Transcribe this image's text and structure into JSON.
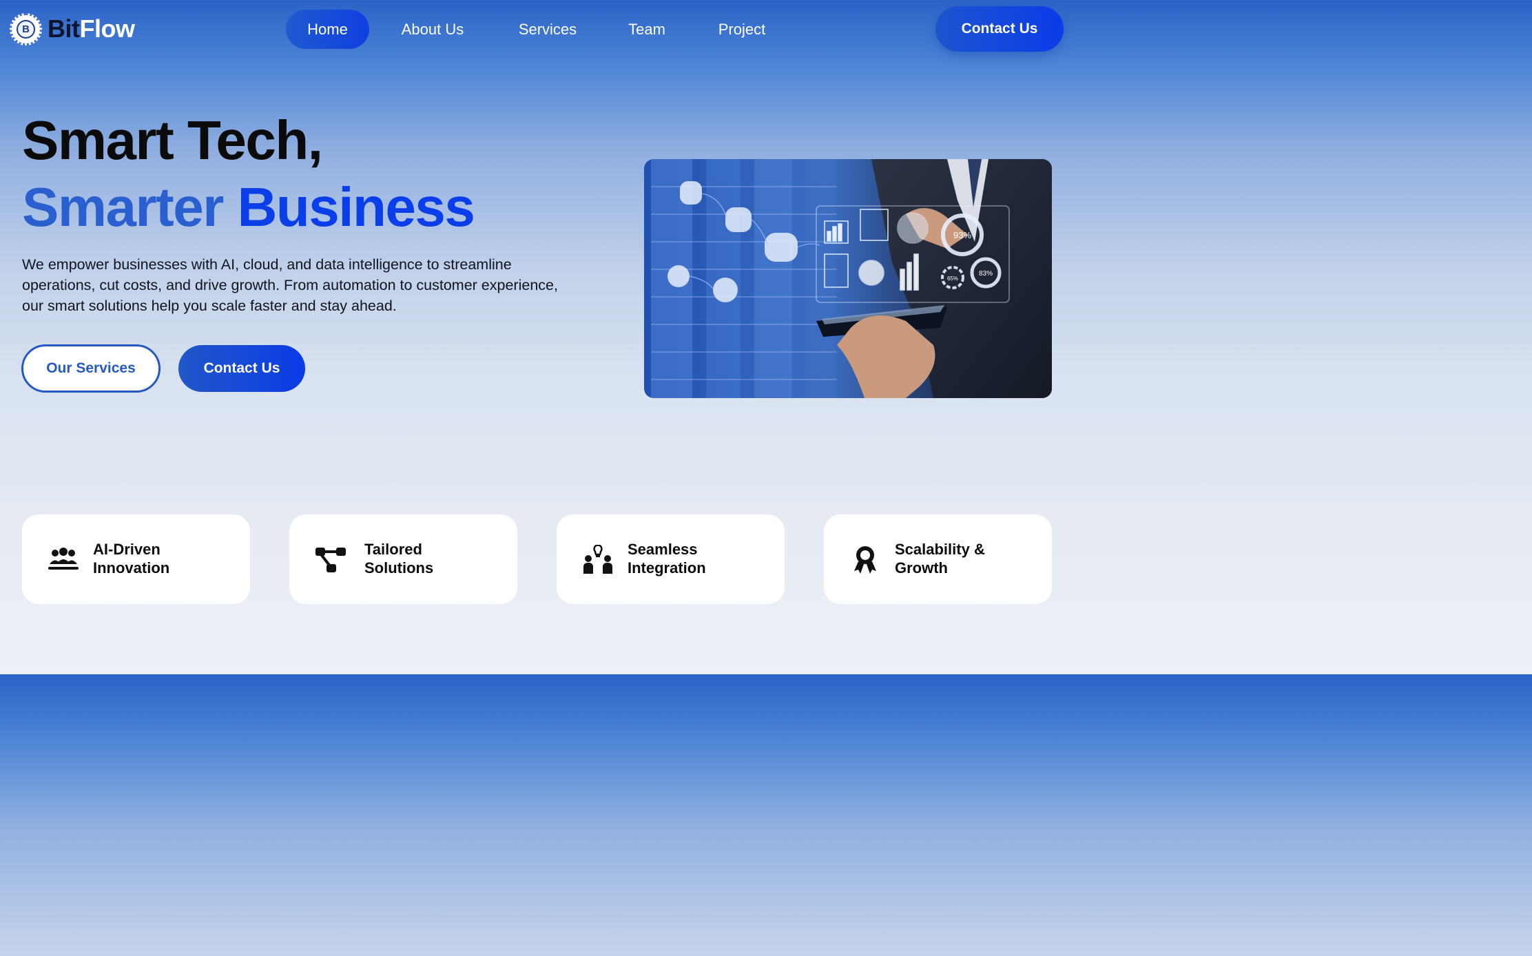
{
  "brand": {
    "name_part1": "Bit",
    "name_part2": "Flow",
    "badge_letter": "B"
  },
  "nav": {
    "items": [
      {
        "label": "Home",
        "active": true
      },
      {
        "label": "About Us",
        "active": false
      },
      {
        "label": "Services",
        "active": false
      },
      {
        "label": "Team",
        "active": false
      },
      {
        "label": "Project",
        "active": false
      }
    ],
    "contact_label": "Contact Us"
  },
  "hero": {
    "title_line1": "Smart Tech,",
    "title_line2_word1": "Smarter",
    "title_line2_word2": "Business",
    "description": "We empower businesses with AI, cloud, and data intelligence to streamline operations, cut costs, and drive growth. From automation to customer experience, our smart solutions help you scale faster and stay ahead.",
    "primary_button": "Our Services",
    "secondary_button": "Contact Us",
    "image_labels": {
      "gauge_large": "93%",
      "gauge_small_1": "65%",
      "gauge_small_2": "83%"
    }
  },
  "features": [
    {
      "icon": "team-icon",
      "line1": "AI-Driven",
      "line2": "Innovation"
    },
    {
      "icon": "flowchart-icon",
      "line1": "Tailored",
      "line2": "Solutions"
    },
    {
      "icon": "collaboration-icon",
      "line1": "Seamless",
      "line2": "Integration"
    },
    {
      "icon": "award-icon",
      "line1": "Scalability &",
      "line2": "Growth"
    }
  ],
  "colors": {
    "accent": "#0a3ee8",
    "accent_soft": "#2a5fcf",
    "header_blue": "#2a63c7",
    "text_dark": "#0b0b0b",
    "card_bg": "#ffffff"
  }
}
